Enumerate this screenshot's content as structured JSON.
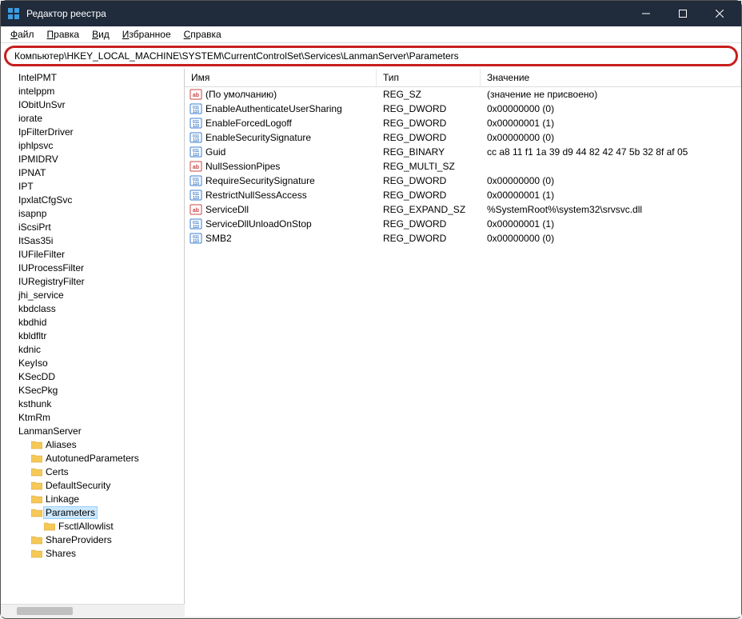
{
  "window": {
    "title": "Редактор реестра"
  },
  "menu": {
    "file": "Файл",
    "edit": "Правка",
    "view": "Вид",
    "favorites": "Избранное",
    "help": "Справка"
  },
  "address": "Компьютер\\HKEY_LOCAL_MACHINE\\SYSTEM\\CurrentControlSet\\Services\\LanmanServer\\Parameters",
  "tree": [
    {
      "label": "IntelPMT",
      "folder": false,
      "indent": 0
    },
    {
      "label": "intelppm",
      "folder": false,
      "indent": 0
    },
    {
      "label": "IObitUnSvr",
      "folder": false,
      "indent": 0
    },
    {
      "label": "iorate",
      "folder": false,
      "indent": 0
    },
    {
      "label": "IpFilterDriver",
      "folder": false,
      "indent": 0
    },
    {
      "label": "iphlpsvc",
      "folder": false,
      "indent": 0
    },
    {
      "label": "IPMIDRV",
      "folder": false,
      "indent": 0
    },
    {
      "label": "IPNAT",
      "folder": false,
      "indent": 0
    },
    {
      "label": "IPT",
      "folder": false,
      "indent": 0
    },
    {
      "label": "IpxlatCfgSvc",
      "folder": false,
      "indent": 0
    },
    {
      "label": "isapnp",
      "folder": false,
      "indent": 0
    },
    {
      "label": "iScsiPrt",
      "folder": false,
      "indent": 0
    },
    {
      "label": "ItSas35i",
      "folder": false,
      "indent": 0
    },
    {
      "label": "IUFileFilter",
      "folder": false,
      "indent": 0
    },
    {
      "label": "IUProcessFilter",
      "folder": false,
      "indent": 0
    },
    {
      "label": "IURegistryFilter",
      "folder": false,
      "indent": 0
    },
    {
      "label": "jhi_service",
      "folder": false,
      "indent": 0
    },
    {
      "label": "kbdclass",
      "folder": false,
      "indent": 0
    },
    {
      "label": "kbdhid",
      "folder": false,
      "indent": 0
    },
    {
      "label": "kbldfltr",
      "folder": false,
      "indent": 0
    },
    {
      "label": "kdnic",
      "folder": false,
      "indent": 0
    },
    {
      "label": "KeyIso",
      "folder": false,
      "indent": 0
    },
    {
      "label": "KSecDD",
      "folder": false,
      "indent": 0
    },
    {
      "label": "KSecPkg",
      "folder": false,
      "indent": 0
    },
    {
      "label": "ksthunk",
      "folder": false,
      "indent": 0
    },
    {
      "label": "KtmRm",
      "folder": false,
      "indent": 0
    },
    {
      "label": "LanmanServer",
      "folder": false,
      "indent": 0
    },
    {
      "label": "Aliases",
      "folder": true,
      "indent": 1
    },
    {
      "label": "AutotunedParameters",
      "folder": true,
      "indent": 1
    },
    {
      "label": "Certs",
      "folder": true,
      "indent": 1
    },
    {
      "label": "DefaultSecurity",
      "folder": true,
      "indent": 1
    },
    {
      "label": "Linkage",
      "folder": true,
      "indent": 1
    },
    {
      "label": "Parameters",
      "folder": true,
      "indent": 1,
      "selected": true
    },
    {
      "label": "FsctlAllowlist",
      "folder": true,
      "indent": 2
    },
    {
      "label": "ShareProviders",
      "folder": true,
      "indent": 1
    },
    {
      "label": "Shares",
      "folder": true,
      "indent": 1
    }
  ],
  "columns": {
    "name": "Имя",
    "type": "Тип",
    "value": "Значение"
  },
  "values": [
    {
      "icon": "str",
      "name": "(По умолчанию)",
      "type": "REG_SZ",
      "data": "(значение не присвоено)"
    },
    {
      "icon": "bin",
      "name": "EnableAuthenticateUserSharing",
      "type": "REG_DWORD",
      "data": "0x00000000 (0)"
    },
    {
      "icon": "bin",
      "name": "EnableForcedLogoff",
      "type": "REG_DWORD",
      "data": "0x00000001 (1)"
    },
    {
      "icon": "bin",
      "name": "EnableSecuritySignature",
      "type": "REG_DWORD",
      "data": "0x00000000 (0)"
    },
    {
      "icon": "bin",
      "name": "Guid",
      "type": "REG_BINARY",
      "data": "cc a8 11 f1 1a 39 d9 44 82 42 47 5b 32 8f af 05"
    },
    {
      "icon": "str",
      "name": "NullSessionPipes",
      "type": "REG_MULTI_SZ",
      "data": ""
    },
    {
      "icon": "bin",
      "name": "RequireSecuritySignature",
      "type": "REG_DWORD",
      "data": "0x00000000 (0)"
    },
    {
      "icon": "bin",
      "name": "RestrictNullSessAccess",
      "type": "REG_DWORD",
      "data": "0x00000001 (1)"
    },
    {
      "icon": "str",
      "name": "ServiceDll",
      "type": "REG_EXPAND_SZ",
      "data": "%SystemRoot%\\system32\\srvsvc.dll"
    },
    {
      "icon": "bin",
      "name": "ServiceDllUnloadOnStop",
      "type": "REG_DWORD",
      "data": "0x00000001 (1)"
    },
    {
      "icon": "bin",
      "name": "SMB2",
      "type": "REG_DWORD",
      "data": "0x00000000 (0)"
    }
  ]
}
